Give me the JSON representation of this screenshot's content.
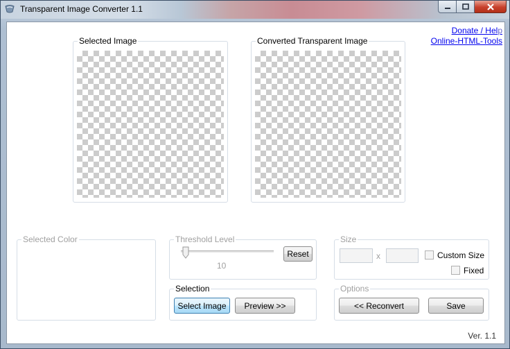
{
  "window": {
    "title": "Transparent Image Converter 1.1",
    "icon": "app-icon",
    "controls": [
      "minimize-icon",
      "maximize-icon",
      "close-icon"
    ]
  },
  "links": {
    "donate_main": "Donate / Hel",
    "donate_tail": "p",
    "online": "Online-HTML-Tools"
  },
  "panels": {
    "selected_image": "Selected Image",
    "converted_image": "Converted Transparent Image"
  },
  "selected_color": {
    "legend": "Selected Color"
  },
  "threshold": {
    "legend": "Threshold Level",
    "value": "10",
    "reset_label": "Reset"
  },
  "selection": {
    "legend": "Selection",
    "select_label": "Select Image",
    "preview_label": "Preview >>"
  },
  "size": {
    "legend": "Size",
    "separator": "x",
    "custom_label": "Custom Size",
    "fixed_label": "Fixed",
    "width": "",
    "height": ""
  },
  "options": {
    "legend": "Options",
    "reconvert_label": "<< Reconvert",
    "save_label": "Save"
  },
  "version": "Ver. 1.1"
}
